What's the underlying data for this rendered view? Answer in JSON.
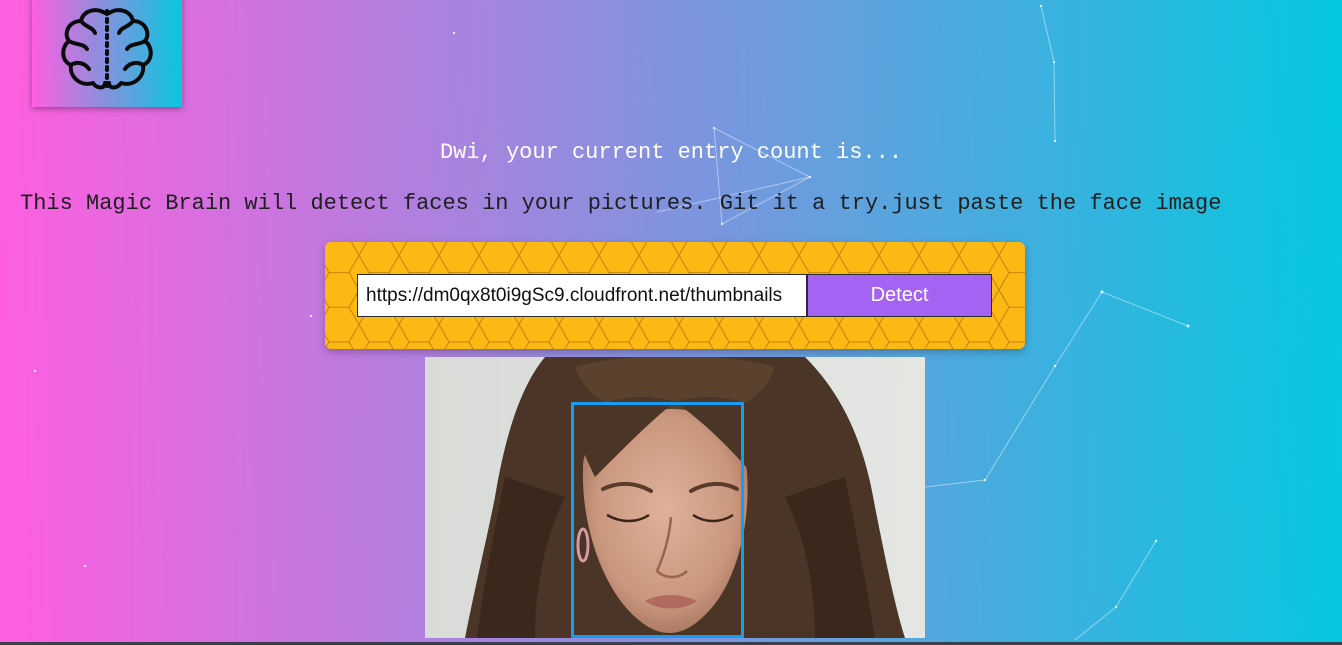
{
  "logo": {
    "icon": "brain-icon",
    "gradient": [
      "#ff5edf",
      "#04c8de"
    ]
  },
  "rank": {
    "message": "Dwi, your current entry count is..."
  },
  "intro": {
    "text": "This Magic Brain will detect faces in your pictures. Git it a try.just paste the face image"
  },
  "form": {
    "url_value": "https://dm0qx8t0i9gSc9.cloudfront.net/thumbnails",
    "detect_label": "Detect",
    "panel_color": "#fdb913",
    "button_color": "#a463f2"
  },
  "result": {
    "image": "face-photo",
    "box_color": "#149df2"
  },
  "theme": {
    "gradient_start": "#ff5edf",
    "gradient_end": "#04c8de"
  }
}
